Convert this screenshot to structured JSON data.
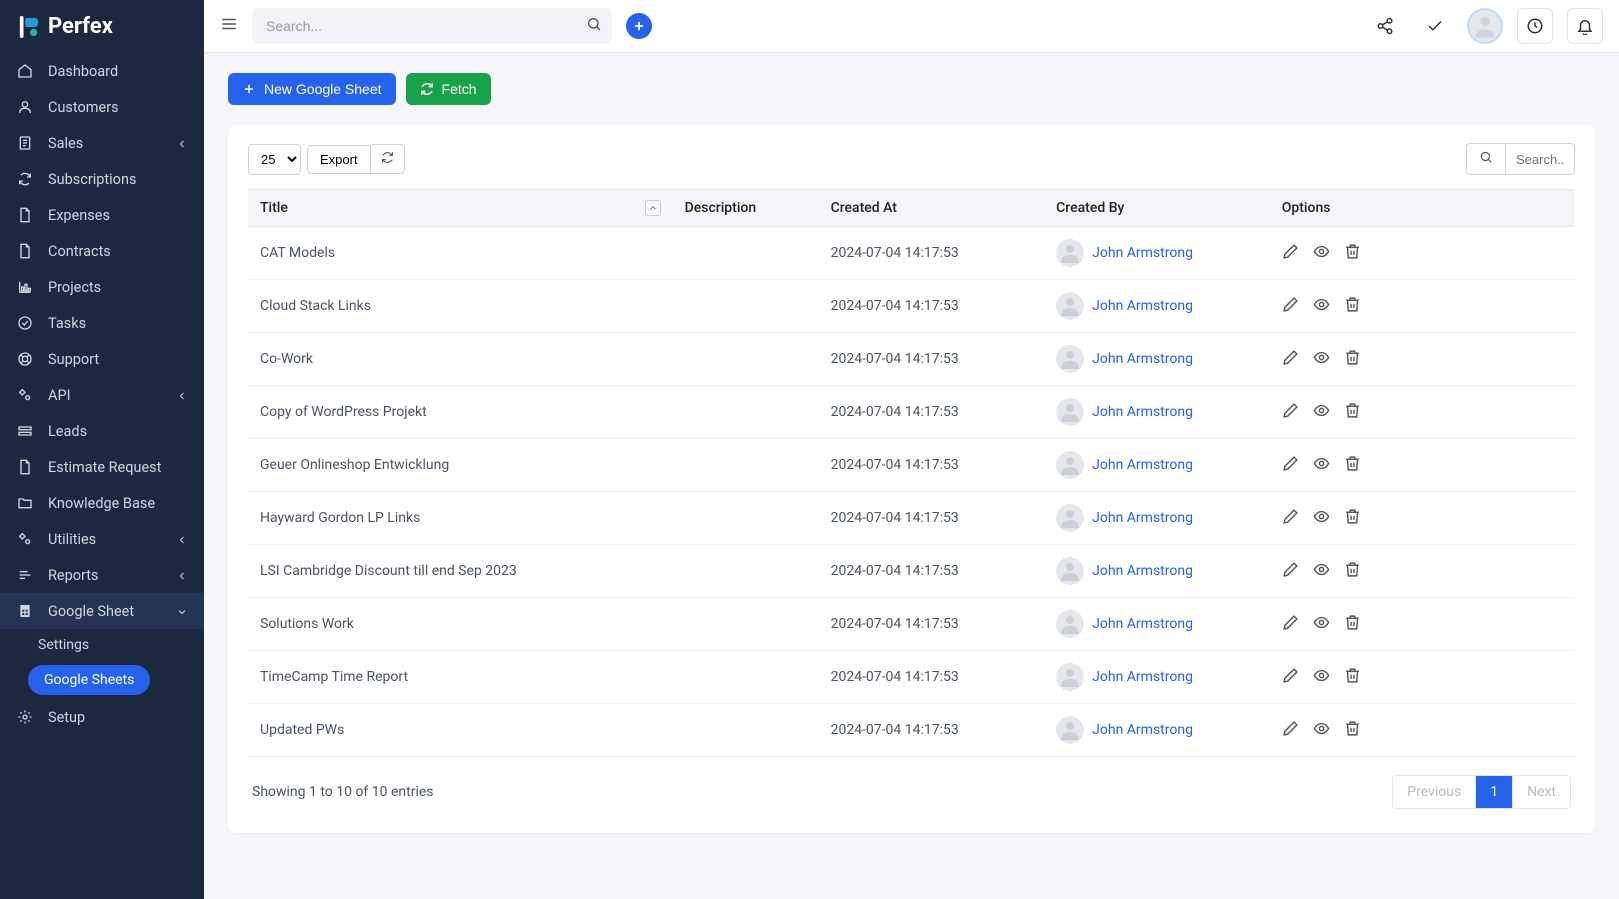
{
  "brand": "Perfex",
  "search_placeholder": "Search...",
  "sidebar": {
    "items": [
      {
        "label": "Dashboard",
        "icon": "home"
      },
      {
        "label": "Customers",
        "icon": "user"
      },
      {
        "label": "Sales",
        "icon": "file",
        "expandable": true
      },
      {
        "label": "Subscriptions",
        "icon": "refresh"
      },
      {
        "label": "Expenses",
        "icon": "doc"
      },
      {
        "label": "Contracts",
        "icon": "doc"
      },
      {
        "label": "Projects",
        "icon": "chart"
      },
      {
        "label": "Tasks",
        "icon": "check-circle"
      },
      {
        "label": "Support",
        "icon": "life-ring"
      },
      {
        "label": "API",
        "icon": "gears",
        "expandable": true
      },
      {
        "label": "Leads",
        "icon": "leads"
      },
      {
        "label": "Estimate Request",
        "icon": "doc"
      },
      {
        "label": "Knowledge Base",
        "icon": "folder"
      },
      {
        "label": "Utilities",
        "icon": "gears",
        "expandable": true
      },
      {
        "label": "Reports",
        "icon": "bars",
        "expandable": true
      },
      {
        "label": "Google Sheet",
        "icon": "sheet",
        "expandable": true,
        "active": true
      },
      {
        "label": "Setup",
        "icon": "gear"
      }
    ],
    "sub": {
      "settings": "Settings",
      "google_sheets": "Google Sheets"
    }
  },
  "actions": {
    "new_sheet": "New Google Sheet",
    "fetch": "Fetch"
  },
  "table": {
    "length_value": "25",
    "export_label": "Export",
    "search_placeholder": "Search..",
    "columns": {
      "title": "Title",
      "description": "Description",
      "created_at": "Created At",
      "created_by": "Created By",
      "options": "Options"
    },
    "rows": [
      {
        "title": "CAT Models",
        "description": "",
        "created_at": "2024-07-04 14:17:53",
        "created_by": "John Armstrong"
      },
      {
        "title": "Cloud Stack Links",
        "description": "",
        "created_at": "2024-07-04 14:17:53",
        "created_by": "John Armstrong"
      },
      {
        "title": "Co-Work",
        "description": "",
        "created_at": "2024-07-04 14:17:53",
        "created_by": "John Armstrong"
      },
      {
        "title": "Copy of WordPress Projekt",
        "description": "",
        "created_at": "2024-07-04 14:17:53",
        "created_by": "John Armstrong"
      },
      {
        "title": "Geuer Onlineshop Entwicklung",
        "description": "",
        "created_at": "2024-07-04 14:17:53",
        "created_by": "John Armstrong"
      },
      {
        "title": "Hayward Gordon LP Links",
        "description": "",
        "created_at": "2024-07-04 14:17:53",
        "created_by": "John Armstrong"
      },
      {
        "title": "LSI Cambridge Discount till end Sep 2023",
        "description": "",
        "created_at": "2024-07-04 14:17:53",
        "created_by": "John Armstrong"
      },
      {
        "title": "Solutions Work",
        "description": "",
        "created_at": "2024-07-04 14:17:53",
        "created_by": "John Armstrong"
      },
      {
        "title": "TimeCamp Time Report",
        "description": "",
        "created_at": "2024-07-04 14:17:53",
        "created_by": "John Armstrong"
      },
      {
        "title": "Updated PWs",
        "description": "",
        "created_at": "2024-07-04 14:17:53",
        "created_by": "John Armstrong"
      }
    ],
    "info": "Showing 1 to 10 of 10 entries",
    "pager": {
      "prev": "Previous",
      "pages": [
        "1"
      ],
      "next": "Next",
      "current": "1"
    }
  }
}
